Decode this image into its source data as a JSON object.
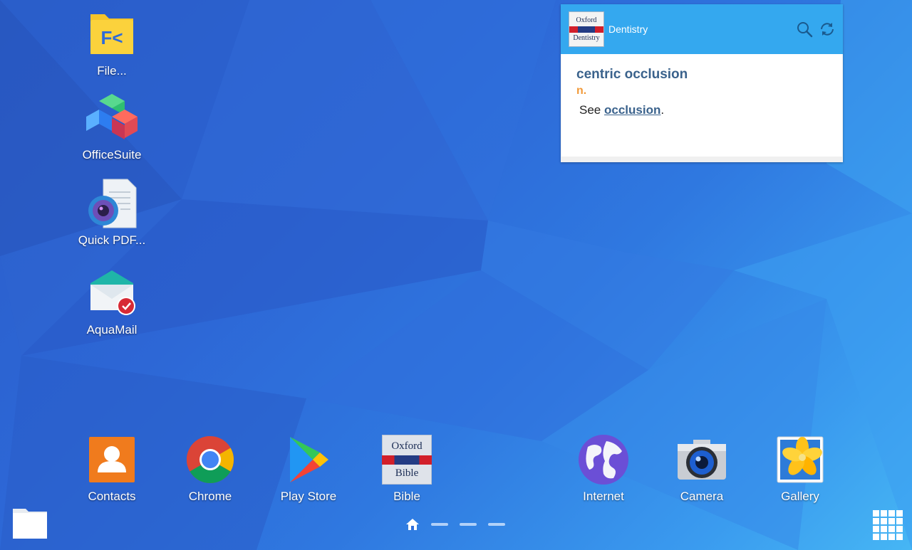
{
  "widget": {
    "book_logo": {
      "line1": "Oxford",
      "line2": "Dentistry"
    },
    "title": "Dentistry",
    "entry": {
      "term": "centric occlusion",
      "pos": "n.",
      "def_prefix": "See ",
      "def_link": "occlusion",
      "def_suffix": "."
    }
  },
  "left_apps": [
    {
      "label": "File..."
    },
    {
      "label": "OfficeSuite"
    },
    {
      "label": "Quick PDF..."
    },
    {
      "label": "AquaMail"
    }
  ],
  "dock_apps": [
    {
      "label": "Contacts"
    },
    {
      "label": "Chrome"
    },
    {
      "label": "Play Store"
    },
    {
      "label": "Bible",
      "logo_line1": "Oxford",
      "logo_line2": "Bible"
    },
    {
      "label": "Internet"
    },
    {
      "label": "Camera"
    },
    {
      "label": "Gallery"
    }
  ],
  "colors": {
    "widget_header": "#34a8ef",
    "term": "#3a628c",
    "pos": "#f29a3a"
  }
}
